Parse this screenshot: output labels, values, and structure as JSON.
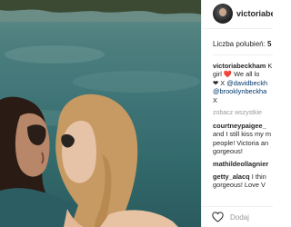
{
  "post": {
    "image_alt": "Photo",
    "username": "victoriabeckham"
  },
  "stats": {
    "likes_label": "Liczba polubień: ",
    "likes_value": "5"
  },
  "caption": {
    "username": "victoriabeckham",
    "lines": [
      "girl ❤️ We all lo",
      "❤ X",
      "@brooklynbeckha",
      "X"
    ],
    "line1_text": " K",
    "mention1": "@davidbeckh",
    "mention2": "@brooklynbeckha"
  },
  "view_all": "zobacz wszystkie",
  "comments": [
    {
      "username": "courtneypaigee_",
      "text": [
        "and I still kiss my m",
        "people! Victoria an",
        "gorgeous!"
      ]
    },
    {
      "username": "mathildeollagnier",
      "text": []
    },
    {
      "username": "getty_alacq",
      "text": [
        "gorgeous! Love V"
      ],
      "text_prefix": "I thin"
    }
  ],
  "footer": {
    "comment_placeholder": "Dodaj"
  },
  "icons": {
    "like": "heart-icon"
  },
  "colors": {
    "mention": "#003569",
    "muted": "#999999",
    "border": "#efefef"
  }
}
